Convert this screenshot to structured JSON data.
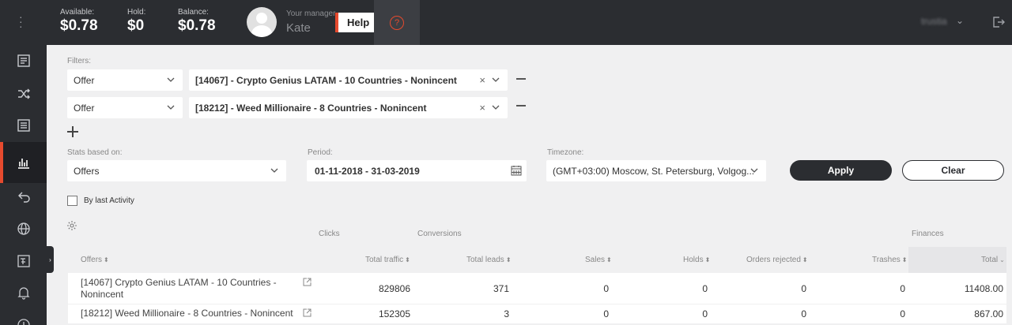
{
  "topbar": {
    "available_label": "Available:",
    "available_value": "$0.78",
    "hold_label": "Hold:",
    "hold_value": "$0",
    "balance_label": "Balance:",
    "balance_value": "$0.78",
    "manager_label": "Your manager",
    "manager_name": "Kate",
    "help_label": "Help",
    "help_icon": "?",
    "user_name": "trustia"
  },
  "filters": {
    "label": "Filters:",
    "rows": [
      {
        "type": "Offer",
        "value": "[14067] - Crypto Genius LATAM - 10 Countries - Nonincent"
      },
      {
        "type": "Offer",
        "value": "[18212] - Weed Millionaire - 8 Countries - Nonincent"
      }
    ]
  },
  "stats": {
    "label": "Stats based on:",
    "value": "Offers"
  },
  "period": {
    "label": "Period:",
    "value": "01-11-2018 - 31-03-2019"
  },
  "timezone": {
    "label": "Timezone:",
    "value": "(GMT+03:00) Moscow, St. Petersburg, Volgog..."
  },
  "buttons": {
    "apply": "Apply",
    "clear": "Clear"
  },
  "by_last_activity": "By last Activity",
  "table": {
    "groups": {
      "clicks": "Clicks",
      "conversions": "Conversions",
      "finances": "Finances"
    },
    "headers": [
      "Offers",
      "Total traffic",
      "Total leads",
      "Sales",
      "Holds",
      "Orders rejected",
      "Trashes",
      "Total"
    ],
    "rows": [
      {
        "offer": "[14067] Crypto Genius LATAM - 10 Countries - Nonincent",
        "traffic": "829806",
        "leads": "371",
        "sales": "0",
        "holds": "0",
        "rejected": "0",
        "trashes": "0",
        "total": "11408.00"
      },
      {
        "offer": "[18212] Weed Millionaire - 8 Countries - Nonincent",
        "traffic": "152305",
        "leads": "3",
        "sales": "0",
        "holds": "0",
        "rejected": "0",
        "trashes": "0",
        "total": "867.00"
      }
    ]
  },
  "colors": {
    "sidebar": "#2b2d31",
    "accent": "#e64a2e",
    "background": "#f0f0f1"
  }
}
